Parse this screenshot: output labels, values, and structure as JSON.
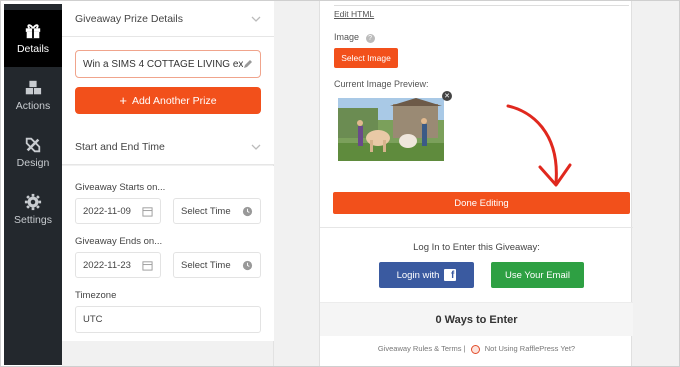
{
  "sidebar": {
    "items": [
      {
        "label": "Details",
        "icon": "gift-icon",
        "active": true
      },
      {
        "label": "Actions",
        "icon": "cubes-icon",
        "active": false
      },
      {
        "label": "Design",
        "icon": "design-tools-icon",
        "active": false
      },
      {
        "label": "Settings",
        "icon": "gear-icon",
        "active": false
      }
    ]
  },
  "settings": {
    "prize_section_title": "Giveaway Prize Details",
    "prize_name": "Win a SIMS 4 COTTAGE LIVING ex...",
    "add_prize_label": "Add Another Prize",
    "time_section_title": "Start and End Time",
    "starts_label": "Giveaway Starts on...",
    "start_date": "2022-11-09",
    "start_time_placeholder": "Select Time",
    "ends_label": "Giveaway Ends on...",
    "end_date": "2022-11-23",
    "end_time_placeholder": "Select Time",
    "timezone_label": "Timezone",
    "timezone_value": "UTC"
  },
  "preview": {
    "edit_html_label": "Edit HTML",
    "image_label": "Image",
    "select_image_label": "Select Image",
    "current_preview_label": "Current Image Preview:",
    "done_label": "Done Editing",
    "login_title": "Log In to Enter this Giveaway:",
    "login_fb_label": "Login with",
    "login_email_label": "Use Your Email",
    "ways_label": "0 Ways to Enter",
    "rules_link": "Giveaway Rules & Terms",
    "separator": "|",
    "not_using_link": "Not Using RafflePress Yet?"
  },
  "colors": {
    "accent": "#f2501b",
    "facebook": "#3a5aa0",
    "email": "#2ea043",
    "sidebar_bg": "#23282d",
    "arrow": "#e0281e"
  }
}
